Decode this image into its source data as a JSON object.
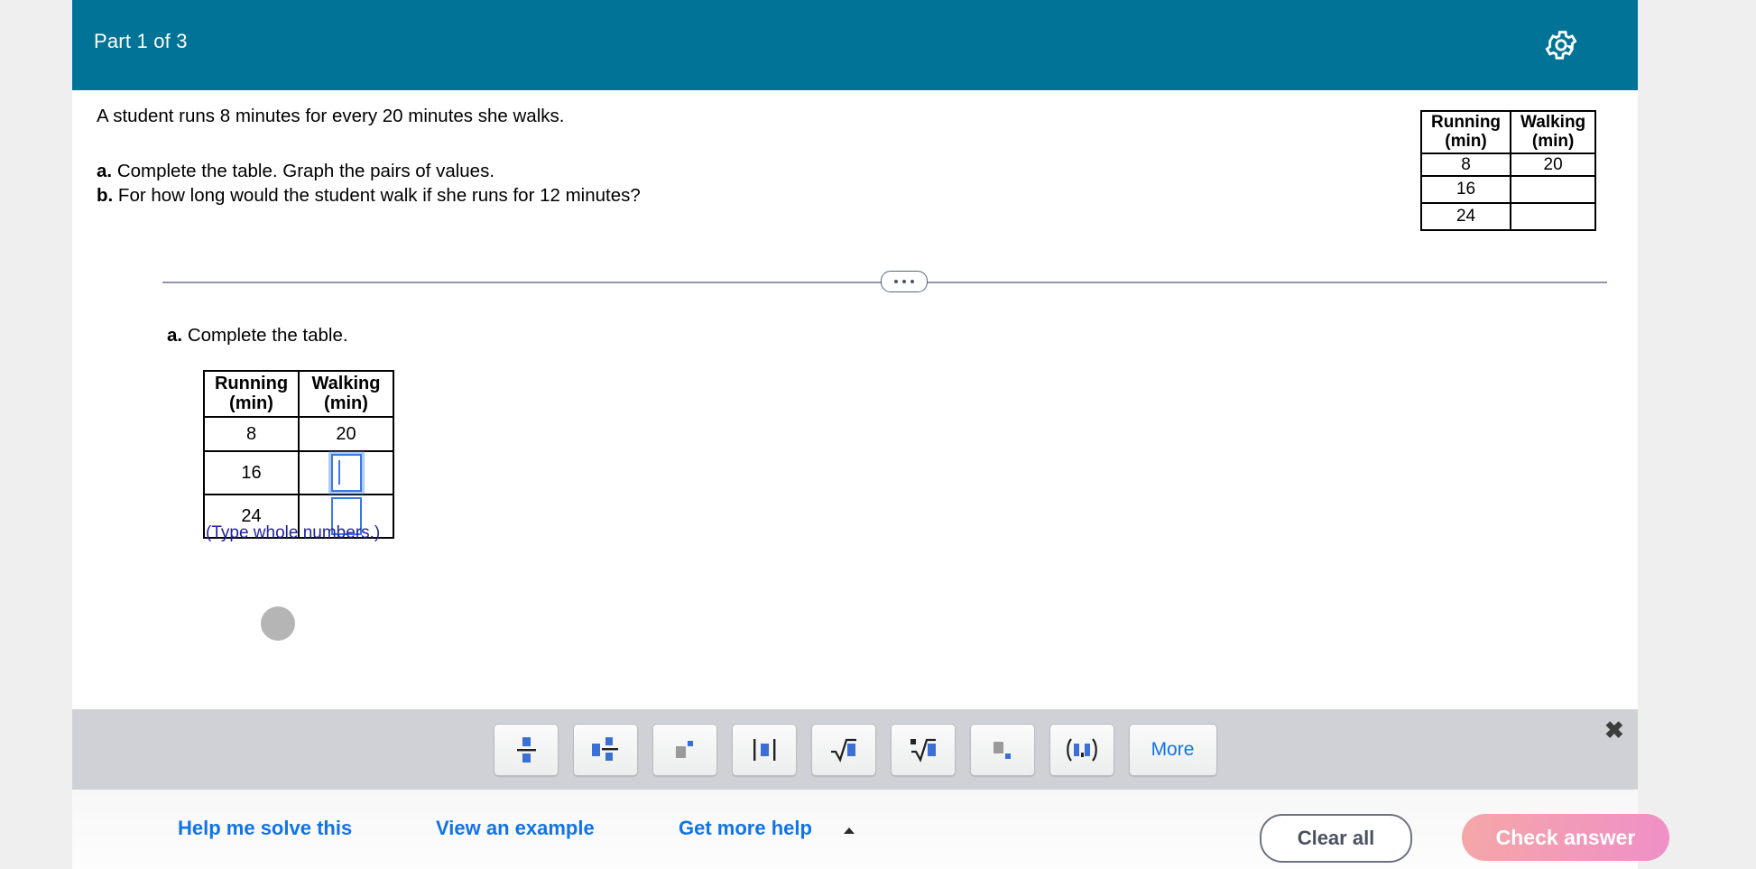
{
  "header": {
    "title": "Part 1 of 3",
    "gear_icon": "gear-icon"
  },
  "problem": {
    "statement": "A student runs 8 minutes for every 20 minutes she walks.",
    "part_a_label": "a.",
    "part_a_text": "Complete the table. Graph the pairs of values.",
    "part_b_label": "b.",
    "part_b_text": "For how long would the student walk if she runs for 12 minutes?"
  },
  "reference_table": {
    "headers": [
      "Running\n(min)",
      "Walking\n(min)"
    ],
    "header_line1": [
      "Running",
      "Walking"
    ],
    "header_line2": [
      "(min)",
      "(min)"
    ],
    "rows": [
      {
        "running": "8",
        "walking": "20"
      },
      {
        "running": "16",
        "walking": ""
      },
      {
        "running": "24",
        "walking": ""
      }
    ]
  },
  "divider": {
    "icon": "ellipsis-icon"
  },
  "work_area": {
    "part_label": "a.",
    "part_text": "Complete the table.",
    "table": {
      "header_line1": [
        "Running",
        "Walking"
      ],
      "header_line2": [
        "(min)",
        "(min)"
      ],
      "rows": [
        {
          "running": "8",
          "walking_value": "20",
          "walking_is_input": false,
          "focused": false
        },
        {
          "running": "16",
          "walking_value": "",
          "walking_is_input": true,
          "focused": true
        },
        {
          "running": "24",
          "walking_value": "",
          "walking_is_input": true,
          "focused": false
        }
      ]
    },
    "hint": "(Type whole numbers.)"
  },
  "math_toolbar": {
    "buttons": [
      {
        "name": "fraction-button",
        "label": ""
      },
      {
        "name": "mixed-number-button",
        "label": ""
      },
      {
        "name": "exponent-button",
        "label": ""
      },
      {
        "name": "absolute-value-button",
        "label": ""
      },
      {
        "name": "square-root-button",
        "label": ""
      },
      {
        "name": "nth-root-button",
        "label": ""
      },
      {
        "name": "subscript-button",
        "label": ""
      },
      {
        "name": "ordered-pair-button",
        "label": ""
      }
    ],
    "more_label": "More",
    "close_label": "✖"
  },
  "footer": {
    "help_link": "Help me solve this",
    "example_link": "View an example",
    "more_help_link": "Get more help",
    "clear_label": "Clear all",
    "check_label": "Check answer"
  },
  "colors": {
    "header_teal": "#007396",
    "link_blue": "#1273e6",
    "hint_navy": "#22229c",
    "input_blue": "#3b78e7",
    "toolbar_gray": "#cfd1d6",
    "check_pink": "#ef8fc8"
  }
}
